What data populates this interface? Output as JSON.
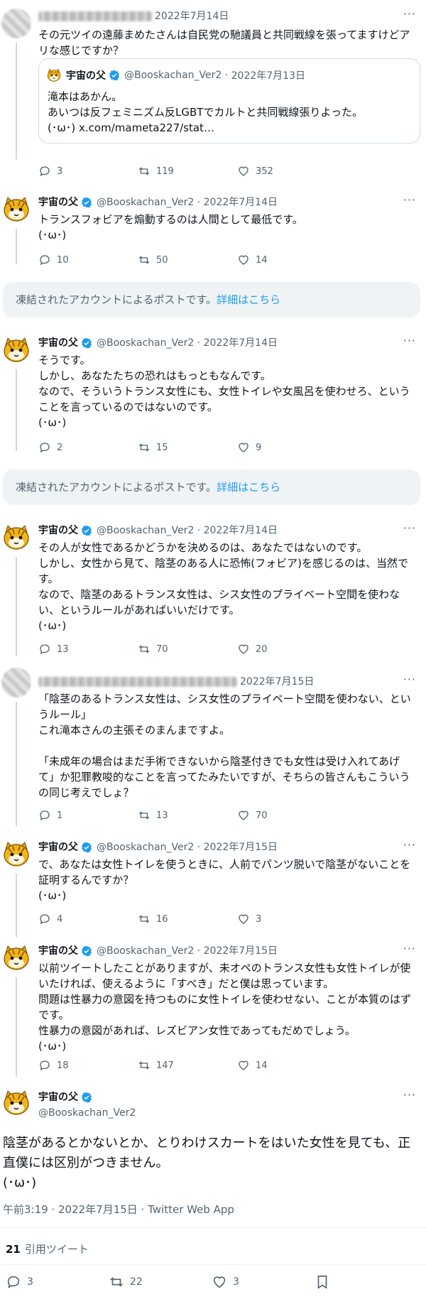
{
  "colors": {
    "accent": "#1d9bf0",
    "muted": "#536471",
    "text": "#0f1419"
  },
  "quote_tweet": {
    "name": "宇宙の父",
    "handle": "@Booskachan_Ver2",
    "date": "2022年7月13日",
    "text": "滝本はあかん。\nあいつは反フェミニズム反LGBTでカルトと共同戦線張りよった。\n(･ω･) x.com/mameta227/stat…"
  },
  "tweets": [
    {
      "name": "",
      "handle": "",
      "date": "2022年7月14日",
      "text": "その元ツイの遠藤まめたさんは自民党の馳議員と共同戦線を張ってますけどアリな感じですか？",
      "replies": "3",
      "retweets": "119",
      "likes": "352"
    },
    {
      "name": "宇宙の父",
      "handle": "@Booskachan_Ver2",
      "date": "2022年7月14日",
      "text": "トランスフォビアを煽動するのは人間として最低です。\n(･ω･)",
      "replies": "10",
      "retweets": "50",
      "likes": "14"
    },
    {
      "name": "宇宙の父",
      "handle": "@Booskachan_Ver2",
      "date": "2022年7月14日",
      "text": "そうです。\nしかし、あなたたちの恐れはもっともなんです。\nなので、そういうトランス女性にも、女性トイレや女風呂を使わせろ、ということを言っているのではないのです。\n(･ω･)",
      "replies": "2",
      "retweets": "15",
      "likes": "9"
    },
    {
      "name": "宇宙の父",
      "handle": "@Booskachan_Ver2",
      "date": "2022年7月14日",
      "text": "その人が女性であるかどうかを決めるのは、あなたではないのです。\nしかし、女性から見て、陰茎のある人に恐怖(フォビア)を感じるのは、当然です。\nなので、陰茎のあるトランス女性は、シス女性のプライベート空間を使わない、というルールがあればいいだけです。\n(･ω･)",
      "replies": "13",
      "retweets": "70",
      "likes": "20"
    },
    {
      "name": "",
      "handle": "",
      "date": "2022年7月15日",
      "text": "「陰茎のあるトランス女性は、シス女性のプライベート空間を使わない、というルール」\nこれ滝本さんの主張そのまんまですよ。\n\n「未成年の場合はまだ手術できないから陰茎付きでも女性は受け入れてあげて」か犯罪教唆的なことを言ってたみたいですが、そちらの皆さんもこういうの同じ考えでしょ？",
      "replies": "1",
      "retweets": "13",
      "likes": "70"
    },
    {
      "name": "宇宙の父",
      "handle": "@Booskachan_Ver2",
      "date": "2022年7月15日",
      "text": "で、あなたは女性トイレを使うときに、人前でパンツ脱いで陰茎がないことを証明するんですか？\n(･ω･)",
      "replies": "4",
      "retweets": "16",
      "likes": "3"
    },
    {
      "name": "宇宙の父",
      "handle": "@Booskachan_Ver2",
      "date": "2022年7月15日",
      "text": "以前ツイートしたことがありますが、未オペのトランス女性も女性トイレが使いたければ、使えるように「すべき」だと僕は思っています。\n問題は性暴力の意図を持つものに女性トイレを使わせない、ことが本質のはずです。\n性暴力の意図があれば、レズビアン女性であってもだめでしょう。\n(･ω･)",
      "replies": "18",
      "retweets": "147",
      "likes": "14"
    }
  ],
  "notice": {
    "text": "凍結されたアカウントによるポストです。",
    "link": "詳細はこちら"
  },
  "main": {
    "name": "宇宙の父",
    "handle": "@Booskachan_Ver2",
    "text": "陰茎があるとかないとか、とりわけスカートをはいた女性を見ても、正直僕には区別がつきません。\n(･ω･)",
    "meta": "午前3:19 · 2022年7月15日 · Twitter Web App",
    "quote_count": "21",
    "quote_label": "引用ツイート",
    "replies": "3",
    "retweets": "22",
    "likes": "3"
  },
  "icons": [
    "reply-icon",
    "retweet-icon",
    "like-icon",
    "bookmark-icon",
    "verified-badge-icon",
    "more-icon"
  ]
}
